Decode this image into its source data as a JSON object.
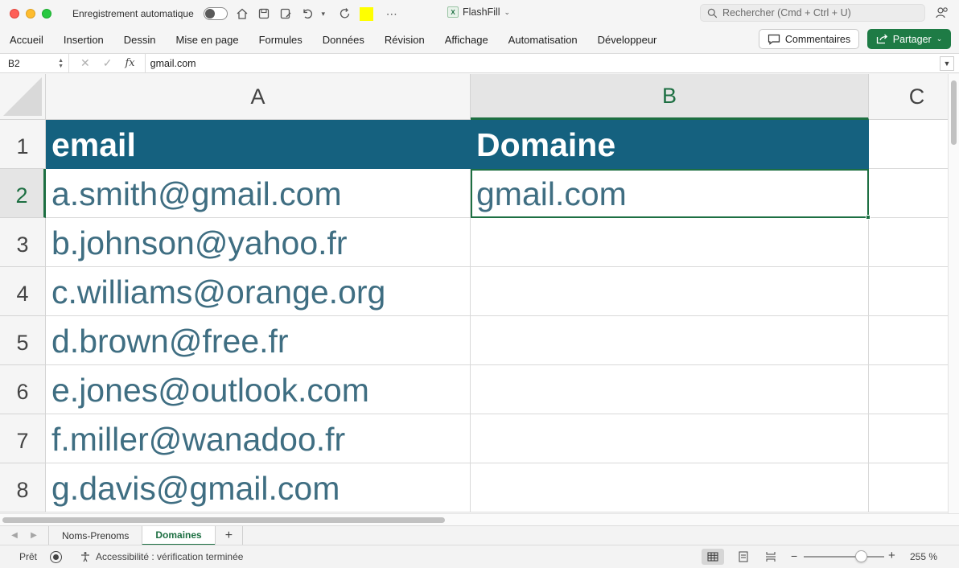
{
  "titlebar": {
    "autosave_label": "Enregistrement automatique",
    "filename": "FlashFill",
    "search_placeholder": "Rechercher (Cmd + Ctrl + U)"
  },
  "ribbon": {
    "tabs": [
      "Accueil",
      "Insertion",
      "Dessin",
      "Mise en page",
      "Formules",
      "Données",
      "Révision",
      "Affichage",
      "Automatisation",
      "Développeur"
    ],
    "comments_label": "Commentaires",
    "share_label": "Partager"
  },
  "formula_bar": {
    "name_box": "B2",
    "fx_label": "fx",
    "content": "gmail.com"
  },
  "grid": {
    "columns": [
      "A",
      "B",
      "C"
    ],
    "selected_column": "B",
    "rows": [
      "1",
      "2",
      "3",
      "4",
      "5",
      "6",
      "7",
      "8"
    ],
    "selected_row": "2",
    "header_fill_color": "#15617f",
    "cells": [
      [
        "email",
        "Domaine"
      ],
      [
        "a.smith@gmail.com",
        "gmail.com"
      ],
      [
        "b.johnson@yahoo.fr",
        ""
      ],
      [
        "c.williams@orange.org",
        ""
      ],
      [
        "d.brown@free.fr",
        ""
      ],
      [
        "e.jones@outlook.com",
        ""
      ],
      [
        "f.miller@wanadoo.fr",
        ""
      ],
      [
        "g.davis@gmail.com",
        ""
      ]
    ]
  },
  "sheets": {
    "tabs": [
      "Noms-Prenoms",
      "Domaines"
    ],
    "active": "Domaines",
    "add_label": "+"
  },
  "statusbar": {
    "ready": "Prêt",
    "accessibility": "Accessibilité : vérification terminée",
    "zoom": "255 %",
    "zoom_level_percent": 255
  }
}
